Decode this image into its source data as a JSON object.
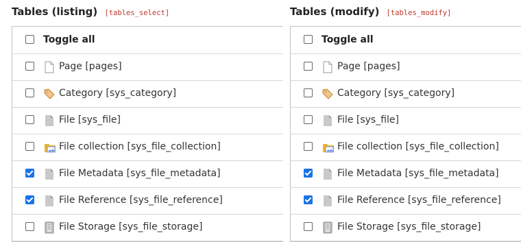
{
  "left": {
    "title": "Tables (listing)",
    "key": "[tables_select]",
    "toggle_label": "Toggle all",
    "items": [
      {
        "label": "Page [pages]",
        "checked": false,
        "icon": "page-icon"
      },
      {
        "label": "Category [sys_category]",
        "checked": false,
        "icon": "tag-icon"
      },
      {
        "label": "File [sys_file]",
        "checked": false,
        "icon": "file-icon"
      },
      {
        "label": "File collection [sys_file_collection]",
        "checked": false,
        "icon": "folder-image-icon"
      },
      {
        "label": "File Metadata [sys_file_metadata]",
        "checked": true,
        "icon": "file-icon"
      },
      {
        "label": "File Reference [sys_file_reference]",
        "checked": true,
        "icon": "file-icon"
      },
      {
        "label": "File Storage [sys_file_storage]",
        "checked": false,
        "icon": "storage-icon"
      }
    ]
  },
  "right": {
    "title": "Tables (modify)",
    "key": "[tables_modify]",
    "toggle_label": "Toggle all",
    "items": [
      {
        "label": "Page [pages]",
        "checked": false,
        "icon": "page-icon"
      },
      {
        "label": "Category [sys_category]",
        "checked": false,
        "icon": "tag-icon"
      },
      {
        "label": "File [sys_file]",
        "checked": false,
        "icon": "file-icon"
      },
      {
        "label": "File collection [sys_file_collection]",
        "checked": false,
        "icon": "folder-image-icon"
      },
      {
        "label": "File Metadata [sys_file_metadata]",
        "checked": true,
        "icon": "file-icon"
      },
      {
        "label": "File Reference [sys_file_reference]",
        "checked": true,
        "icon": "file-icon"
      },
      {
        "label": "File Storage [sys_file_storage]",
        "checked": false,
        "icon": "storage-icon"
      }
    ]
  }
}
